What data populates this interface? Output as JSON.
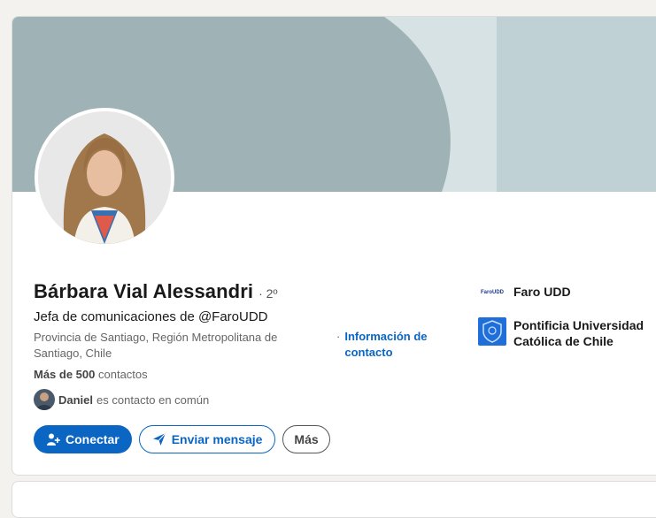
{
  "profile": {
    "name": "Bárbara Vial Alessandri",
    "degree": "· 2º",
    "headline": "Jefa de comunicaciones de @FaroUDD",
    "location": "Provincia de Santiago, Región Metropolitana de Santiago, Chile",
    "contact_separator": "·",
    "contact_info": "Información de contacto",
    "connections_bold": "Más de 500",
    "connections_rest": "contactos",
    "mutual_name": "Daniel",
    "mutual_text": "es contacto en común"
  },
  "actions": {
    "connect": "Conectar",
    "message": "Enviar mensaje",
    "more": "Más"
  },
  "organizations": [
    {
      "name": "Faro UDD",
      "logo_text": "FaroUDD"
    },
    {
      "name": "Pontificia Universidad Católica de Chile"
    }
  ],
  "colors": {
    "accent": "#0a66c2",
    "banner_dark": "#9fb3b7",
    "banner_light": "#bfd1d4",
    "banner_pale": "#d7e2e4"
  }
}
